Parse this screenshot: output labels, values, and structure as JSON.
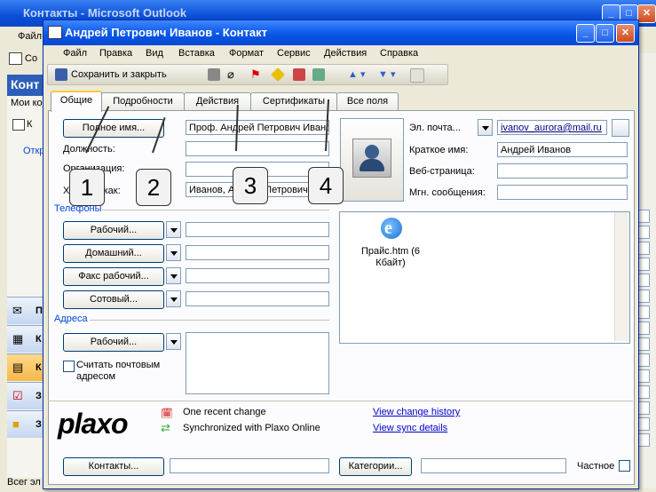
{
  "background_window": {
    "title": "Контакты - Microsoft Outlook",
    "menu_first": "Файл",
    "toolbar_first": "Со",
    "nav_header": "Конт",
    "nav_sub": "Мои ко",
    "nav_item": "К",
    "nav_open": "Откр",
    "nav_buttons": [
      "П",
      "К",
      "К",
      "З",
      "З"
    ],
    "status": "Всег эл"
  },
  "window": {
    "title": "Андрей Петрович Иванов - Контакт",
    "buttons": {
      "minimize": "_",
      "maximize": "□",
      "close": "✕"
    }
  },
  "menu": [
    "Файл",
    "Правка",
    "Вид",
    "Вставка",
    "Формат",
    "Сервис",
    "Действия",
    "Справка"
  ],
  "toolbar": {
    "save_close": "Сохранить и закрыть"
  },
  "tabs": [
    "Общие",
    "Подробности",
    "Действия",
    "Сертификаты",
    "Все поля"
  ],
  "form": {
    "full_name_button": "Полное имя...",
    "full_name_value": "Проф. Андрей Петрович Ивано",
    "position_label": "Должность:",
    "organization_label": "Организация:",
    "file_as_label": "Хранить как:",
    "file_as_value": "Иванов, Андрей Петрович",
    "phones_section": "Телефоны",
    "phone_buttons": [
      "Рабочий...",
      "Домашний...",
      "Факс рабочий...",
      "Сотовый..."
    ],
    "address_section": "Адреса",
    "address_button": "Рабочий...",
    "mailing_address_checkbox": "Считать почтовым адресом",
    "email_button": "Эл. почта...",
    "email_value": "ivanov_aurora@mail.ru",
    "short_name_label": "Краткое имя:",
    "short_name_value": "Андрей Иванов",
    "web_label": "Веб-страница:",
    "im_label": "Мгн. сообщения:",
    "attachment": "Прайс.htm (6 Кбайт)"
  },
  "plaxo": {
    "logo": "plaxo",
    "recent_change": "One recent change",
    "sync": "Synchronized with Plaxo Online",
    "view_history": "View change history",
    "view_sync": "View sync details"
  },
  "footer": {
    "contacts_button": "Контакты...",
    "categories_button": "Категории...",
    "private_label": "Частное"
  },
  "callouts": [
    "1",
    "2",
    "3",
    "4"
  ],
  "colors": {
    "accent_link": "#0046d5",
    "tab_highlight": "#ffc83c",
    "xp_title": "#0a56e6"
  }
}
